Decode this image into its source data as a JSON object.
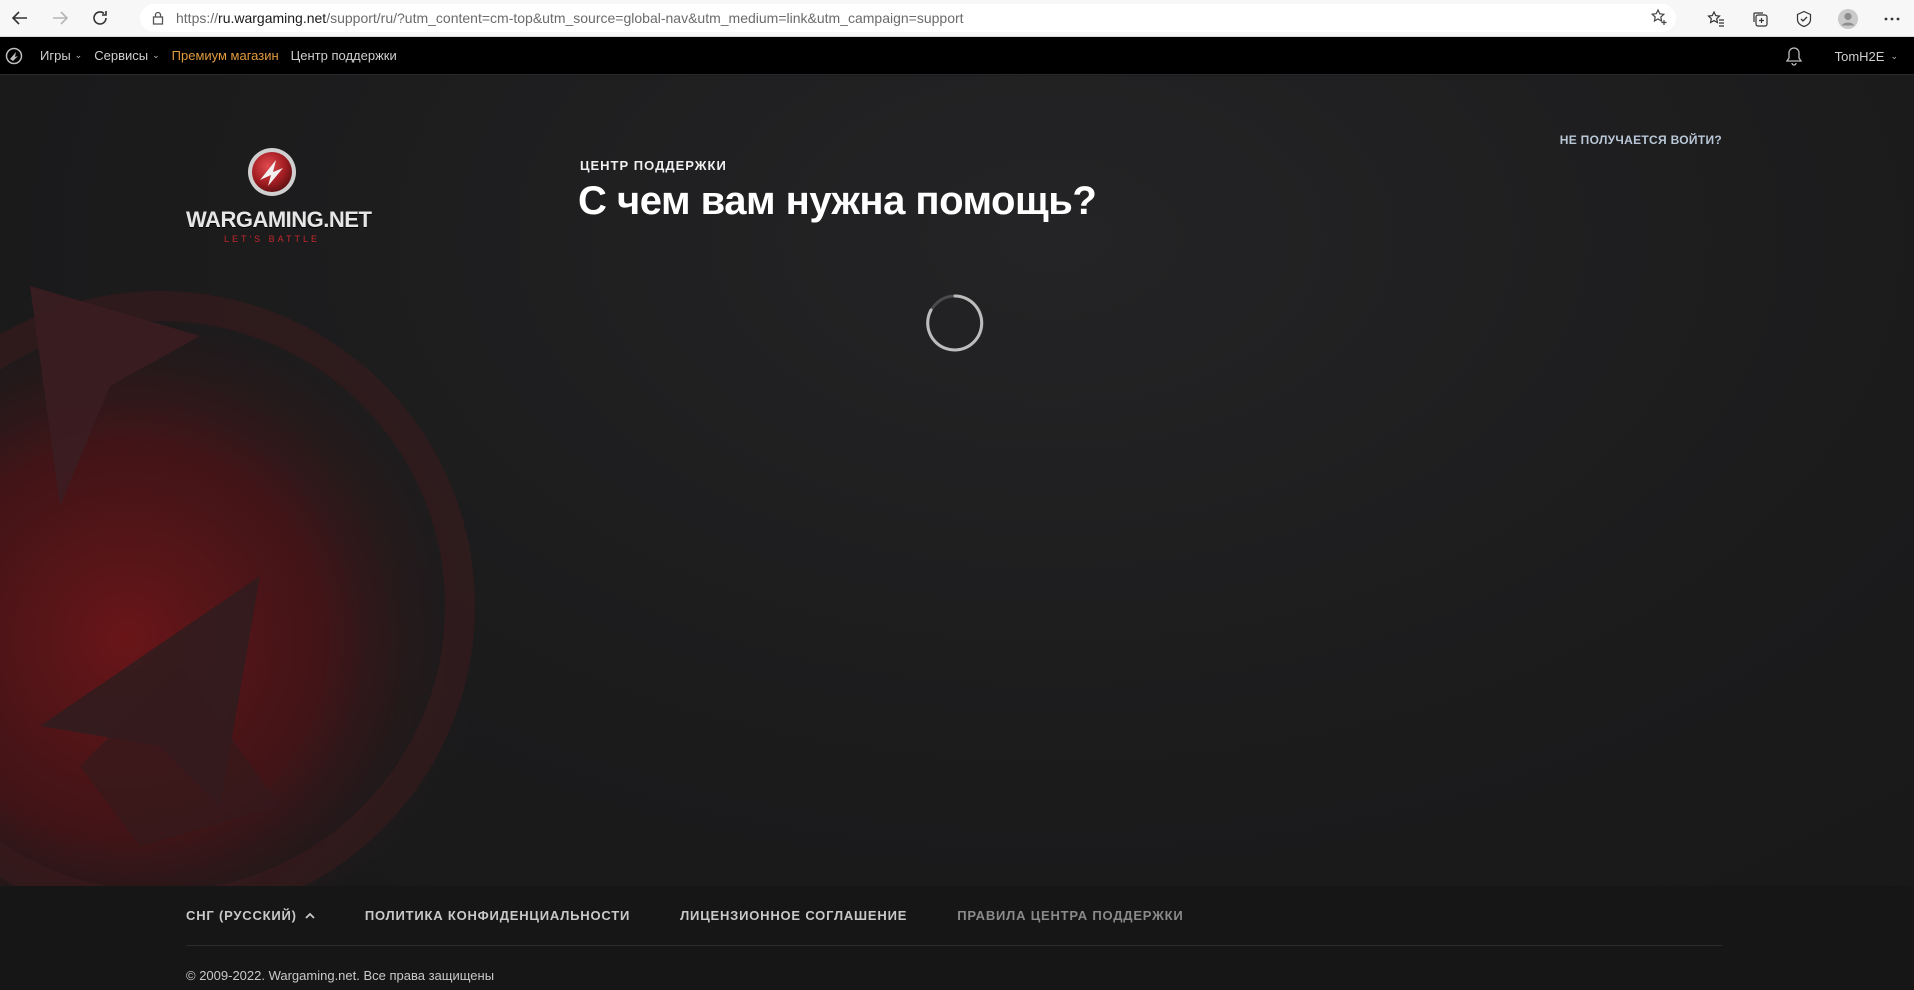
{
  "browser": {
    "url_prefix": "https://",
    "url_domain": "ru.wargaming.net",
    "url_rest": "/support/ru/?utm_content=cm-top&utm_source=global-nav&utm_medium=link&utm_campaign=support"
  },
  "site_nav": {
    "items": [
      {
        "label": "Игры"
      },
      {
        "label": "Сервисы"
      },
      {
        "label": "Премиум магазин"
      },
      {
        "label": "Центр поддержки"
      }
    ],
    "username": "TomH2E"
  },
  "brand": {
    "wordmark": "WARGAMING.NET",
    "tagline": "LET'S BATTLE"
  },
  "main": {
    "section_label": "ЦЕНТР ПОДДЕРЖКИ",
    "title": "С чем вам нужна помощь?",
    "login_help": "НЕ ПОЛУЧАЕТСЯ ВОЙТИ?"
  },
  "footer": {
    "region": "СНГ (РУССКИЙ)",
    "links": [
      {
        "label": "ПОЛИТИКА КОНФИДЕНЦИАЛЬНОСТИ"
      },
      {
        "label": "ЛИЦЕНЗИОННОЕ СОГЛАШЕНИЕ"
      },
      {
        "label": "ПРАВИЛА ЦЕНТРА ПОДДЕРЖКИ"
      }
    ],
    "copyright": "© 2009-2022. Wargaming.net. Все права защищены"
  },
  "colors": {
    "premium": "#e09a3e",
    "brand_red": "#c1272d",
    "background": "#1b1b1c"
  }
}
